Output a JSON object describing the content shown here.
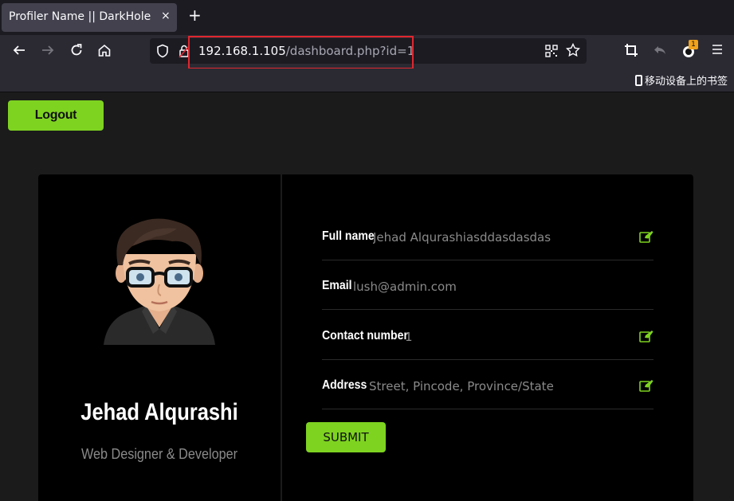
{
  "browser": {
    "tab_title": "Profiler Name || DarkHole",
    "tab_close": "×",
    "new_tab": "+",
    "url_host": "192.168.1.105",
    "url_path": "/dashboard.php?id=1",
    "bookmark_label": "移动设备上的书签",
    "extension_badge": "1"
  },
  "page": {
    "logout_label": "Logout",
    "profile": {
      "name": "Jehad Alqurashi",
      "role": "Web Designer & Developer"
    },
    "fields": [
      {
        "label": "Full name",
        "value": "Jehad Alqurashiasddasdasdas",
        "editable": true
      },
      {
        "label": "Email",
        "value": "lush@admin.com",
        "editable": false
      },
      {
        "label": "Contact number",
        "value": "1",
        "editable": true
      },
      {
        "label": "Address",
        "placeholder": "Street, Pincode, Province/State",
        "editable": true
      }
    ],
    "submit_label": "SUBMIT"
  },
  "colors": {
    "accent": "#7ed321",
    "highlight_border": "#e0262f"
  }
}
